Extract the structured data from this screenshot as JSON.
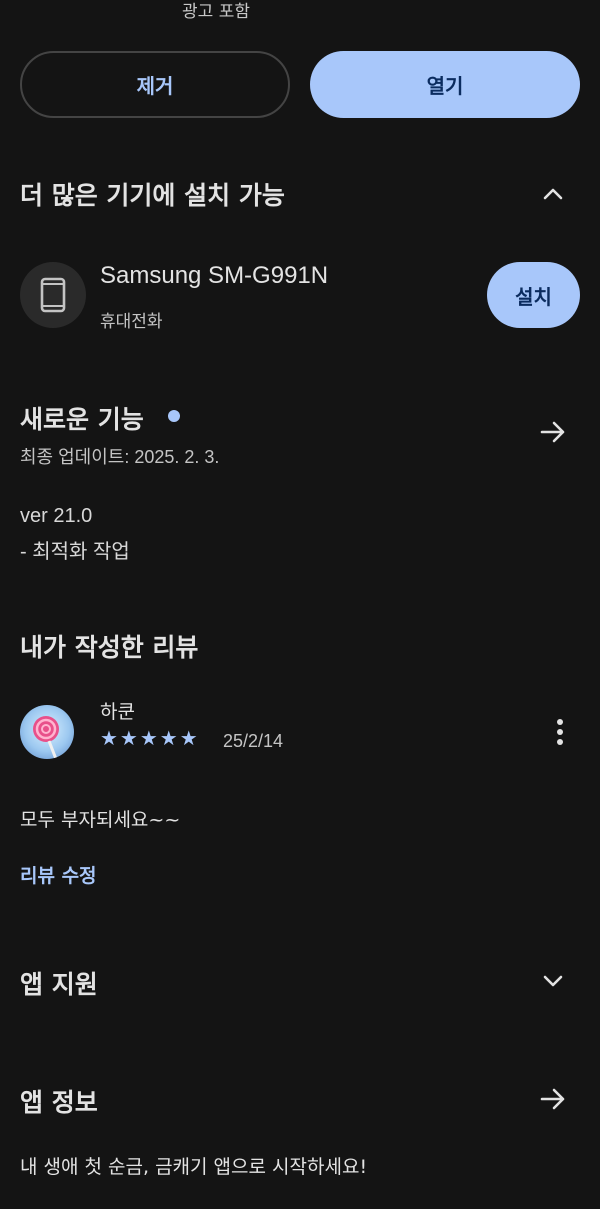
{
  "ad_note": "광고 포함",
  "actions": {
    "remove_label": "제거",
    "open_label": "열기"
  },
  "more_devices": {
    "title": "더 많은 기기에 설치 가능",
    "device": {
      "name": "Samsung SM-G991N",
      "type": "휴대전화",
      "install_label": "설치",
      "icon": "phone-icon"
    }
  },
  "whats_new": {
    "title": "새로운 기능",
    "updated": "최종 업데이트: 2025. 2. 3.",
    "version": "ver 21.0",
    "note": "- 최적화 작업"
  },
  "my_review": {
    "title": "내가 작성한 리뷰",
    "reviewer": "하쿤",
    "rating": 5,
    "stars": "★★★★★",
    "date": "25/2/14",
    "text": "모두 부자되세요~~",
    "edit_label": "리뷰 수정"
  },
  "app_support": {
    "title": "앱 지원"
  },
  "app_info": {
    "title": "앱 정보",
    "description": "내 생애 첫 순금, 금캐기 앱으로 시작하세요!"
  },
  "colors": {
    "accent": "#a8c7fa",
    "background": "#141414",
    "on_accent": "#0b2c5f"
  }
}
